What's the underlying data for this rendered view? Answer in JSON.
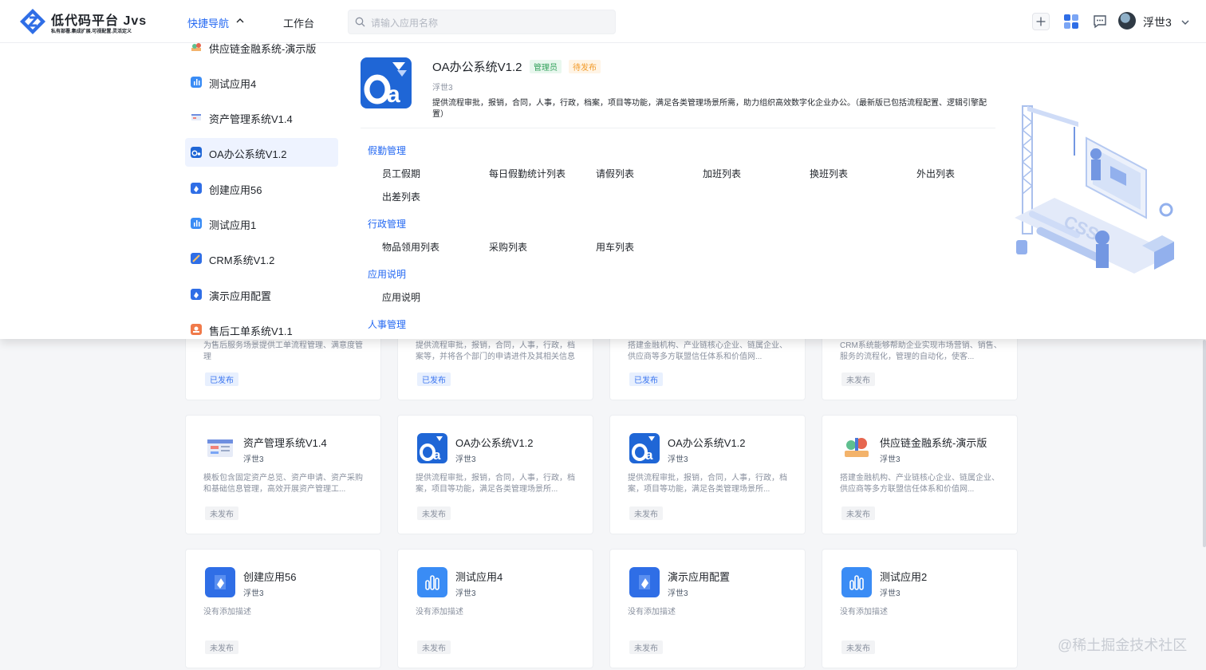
{
  "header": {
    "logo_title": "低代码平台 Jvs",
    "logo_subtitle": "私有部署.集成扩展.可视配置.灵活定义",
    "nav_quick": "快捷导航",
    "nav_workbench": "工作台",
    "search_placeholder": "请输入应用名称",
    "user_name": "浮世3",
    "accent": "#2468f2"
  },
  "quick_nav": {
    "apps": [
      {
        "label": "供应链金融系统-演示版",
        "icon": "supply-chain-icon"
      },
      {
        "label": "测试应用4",
        "icon": "chart-app-icon"
      },
      {
        "label": "资产管理系统V1.4",
        "icon": "asset-icon"
      },
      {
        "label": "OA办公系统V1.2",
        "icon": "oa-icon",
        "active": true
      },
      {
        "label": "创建应用56",
        "icon": "blue-app-icon"
      },
      {
        "label": "测试应用1",
        "icon": "chart-app-icon"
      },
      {
        "label": "CRM系统V1.2",
        "icon": "crm-icon"
      },
      {
        "label": "演示应用配置",
        "icon": "blue-app-icon"
      },
      {
        "label": "售后工单系统V1.1",
        "icon": "ticket-icon"
      }
    ],
    "detail": {
      "title": "OA办公系统V1.2",
      "tag_admin": "管理员",
      "tag_status": "待发布",
      "author": "浮世3",
      "description": "提供流程审批，报销，合同，人事，行政，档案，项目等功能，满足各类管理场景所需，助力组织高效数字化企业办公。（最新版已包括流程配置、逻辑引擎配置）",
      "groups": [
        {
          "title": "假勤管理",
          "links": [
            "员工假期",
            "每日假勤统计列表",
            "请假列表",
            "加班列表",
            "换班列表",
            "外出列表",
            "出差列表"
          ]
        },
        {
          "title": "行政管理",
          "links": [
            "物品领用列表",
            "采购列表",
            "用车列表"
          ]
        },
        {
          "title": "应用说明",
          "links": [
            "应用说明"
          ]
        },
        {
          "title": "人事管理",
          "links": []
        }
      ]
    }
  },
  "cards_top": [
    {
      "desc": "为售后服务场景提供工单流程管理、满意度管理",
      "status": "已发布"
    },
    {
      "desc": "提供流程审批，报销，合同，人事，行政，档案等，并将各个部门的申请进件及其相关信息捏在一起，搭建...",
      "status": "已发布"
    },
    {
      "desc": "搭建金融机构、产业链核心企业、链属企业、供应商等多方联盟信任体系和价值网...",
      "status": "已发布"
    },
    {
      "desc": "CRM系统能够帮助企业实现市场营销、销售、服务的流程化，管理的自动化，使客...",
      "status": "未发布"
    }
  ],
  "cards": [
    {
      "title": "资产管理系统V1.4",
      "author": "浮世3",
      "desc": "模板包含固定资产总览、资产申请、资产采购和基础信息管理，高效开展资产管理工...",
      "status": "未发布",
      "icon": "asset-icon"
    },
    {
      "title": "OA办公系统V1.2",
      "author": "浮世3",
      "desc": "提供流程审批，报销，合同，人事，行政，档案，项目等功能，满足各类管理场景所...",
      "status": "未发布",
      "icon": "oa-icon"
    },
    {
      "title": "OA办公系统V1.2",
      "author": "浮世3",
      "desc": "提供流程审批，报销，合同，人事，行政，档案，项目等功能，满足各类管理场景所...",
      "status": "未发布",
      "icon": "oa-icon"
    },
    {
      "title": "供应链金融系统-演示版",
      "author": "浮世3",
      "desc": "搭建金融机构、产业链核心企业、链属企业、供应商等多方联盟信任体系和价值网...",
      "status": "未发布",
      "icon": "supply-chain-icon"
    },
    {
      "title": "创建应用56",
      "author": "浮世3",
      "desc": "没有添加描述",
      "status": "未发布",
      "icon": "blue-app-icon"
    },
    {
      "title": "测试应用4",
      "author": "浮世3",
      "desc": "没有添加描述",
      "status": "未发布",
      "icon": "chart-app-icon"
    },
    {
      "title": "演示应用配置",
      "author": "浮世3",
      "desc": "没有添加描述",
      "status": "未发布",
      "icon": "blue-app-icon"
    },
    {
      "title": "测试应用2",
      "author": "浮世3",
      "desc": "没有添加描述",
      "status": "未发布",
      "icon": "chart-app-icon"
    }
  ],
  "watermark": "@稀土掘金技术社区"
}
